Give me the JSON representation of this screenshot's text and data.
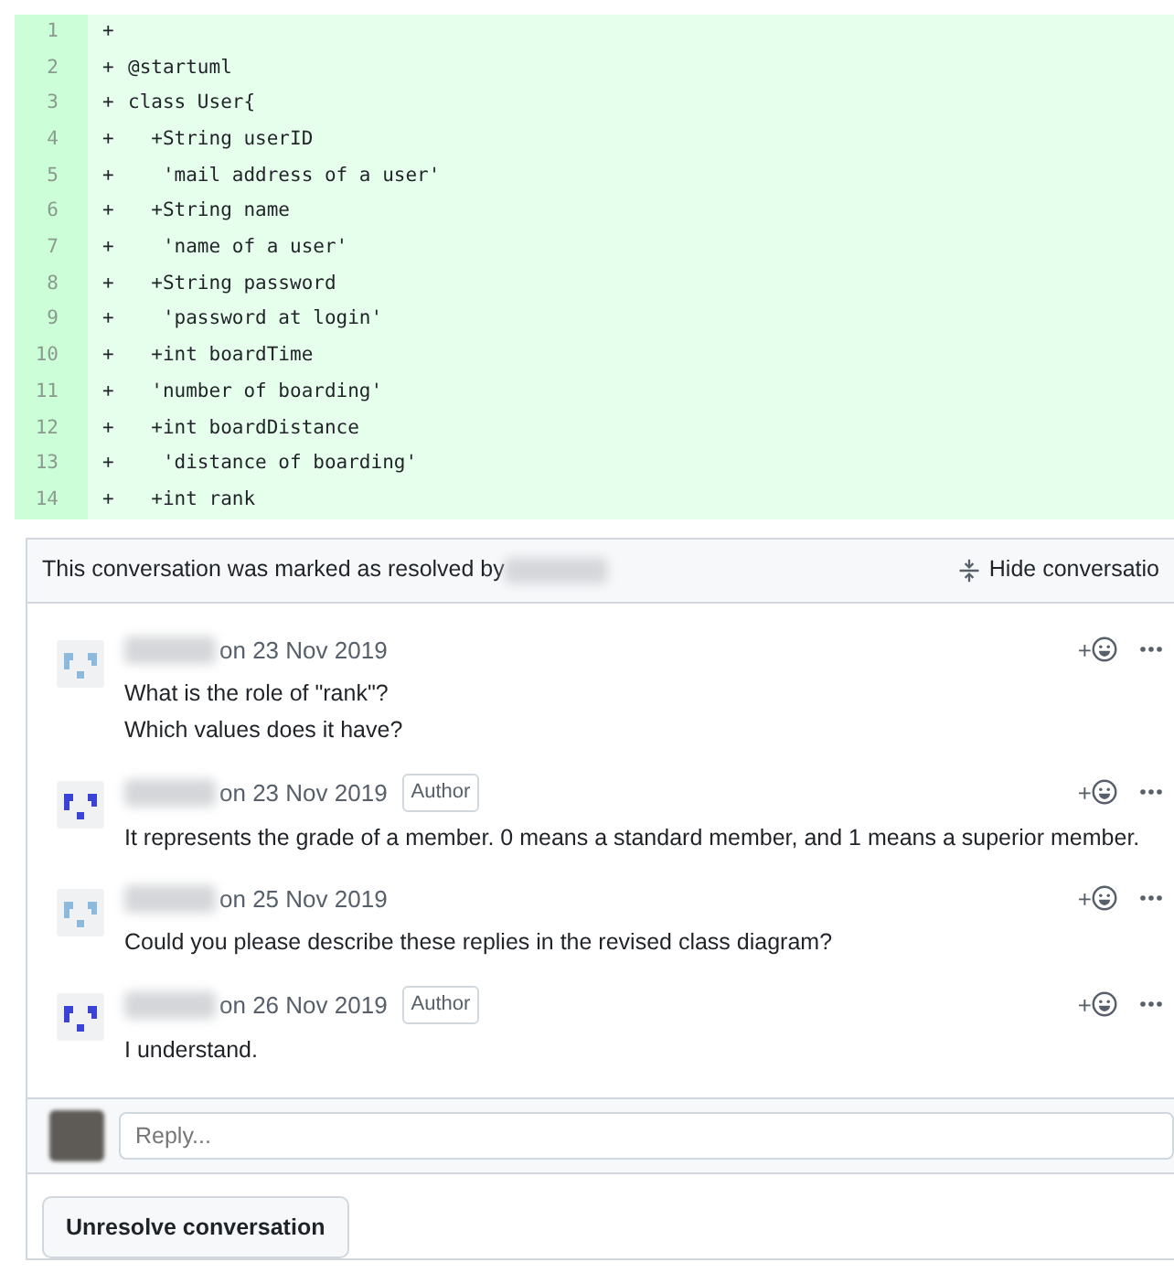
{
  "code_lines": [
    {
      "number": "1",
      "sign": "+"
    },
    {
      "number": "2",
      "sign": "+",
      "text": "@startuml"
    },
    {
      "number": "3",
      "sign": "+",
      "text": "class User{"
    },
    {
      "number": "4",
      "sign": "+",
      "text": "  +String userID"
    },
    {
      "number": "5",
      "sign": "+",
      "text": "   'mail address of a user'"
    },
    {
      "number": "6",
      "sign": "+",
      "text": "  +String name"
    },
    {
      "number": "7",
      "sign": "+",
      "text": "   'name of a user'"
    },
    {
      "number": "8",
      "sign": "+",
      "text": "  +String password"
    },
    {
      "number": "9",
      "sign": "+",
      "text": "   'password at login'"
    },
    {
      "number": "10",
      "sign": "+",
      "text": "  +int boardTime"
    },
    {
      "number": "11",
      "sign": "+",
      "text": "  'number of boarding'"
    },
    {
      "number": "12",
      "sign": "+",
      "text": "  +int boardDistance"
    },
    {
      "number": "13",
      "sign": "+",
      "text": "   'distance of boarding'"
    },
    {
      "number": "14",
      "sign": "+",
      "text": "  +int rank"
    }
  ],
  "conversation": {
    "resolved_text": "This conversation was marked as resolved by",
    "hide_button": "Hide conversatio",
    "comments": [
      {
        "color": "#8db9dc",
        "date": "on 23 Nov 2019",
        "author_badge": false,
        "body": [
          "What is the role of \"rank\"?",
          "Which values does it have?"
        ],
        "reaction": "+"
      },
      {
        "color": "#3b43d6",
        "date": "on 23 Nov 2019",
        "author_badge": true,
        "badge": "Author",
        "body": [
          "It represents the grade of a member. 0 means a standard member, and 1 means a superior member."
        ],
        "reaction": "+"
      },
      {
        "color": "#8db9dc",
        "date": "on 25 Nov 2019",
        "author_badge": false,
        "body": [
          "Could you please describe these replies in the revised class diagram?"
        ],
        "reaction": "+"
      },
      {
        "color": "#3b43d6",
        "date": "on 26 Nov 2019",
        "author_badge": true,
        "badge": "Author",
        "body": [
          "I understand."
        ],
        "reaction": "+"
      }
    ],
    "reply": {
      "placeholder": "Reply..."
    },
    "unresolve_button": "Unresolve conversation"
  }
}
